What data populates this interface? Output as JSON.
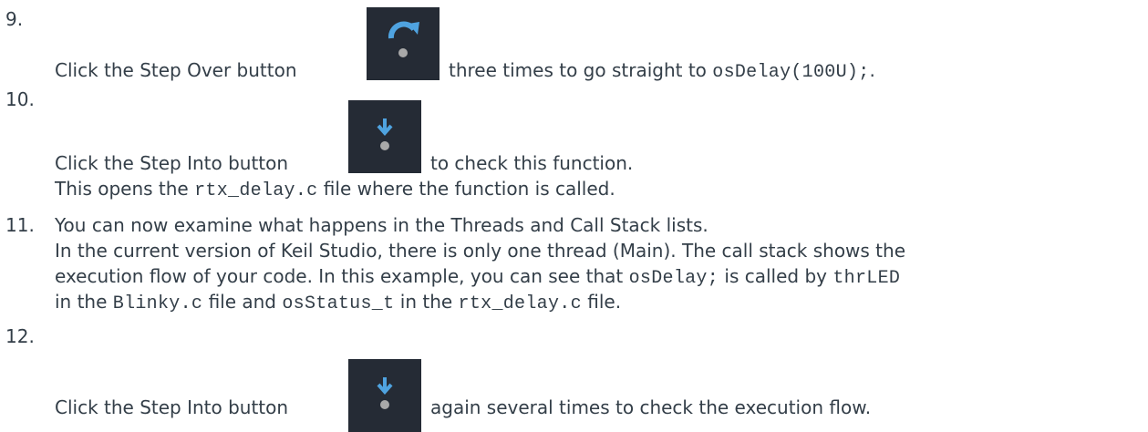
{
  "steps": [
    {
      "number": "9.",
      "icon": "step-over-icon",
      "lines": [
        {
          "before": "Click the Step Over button",
          "after": "three times to go straight to",
          "code": "osDelay(100U);",
          "end": "."
        }
      ]
    },
    {
      "number": "10.",
      "icon": "step-into-icon",
      "lines": [
        {
          "before": "Click the Step Into button",
          "after": "to check this function."
        },
        {
          "text1": "This opens the",
          "code": "rtx_delay.c",
          "text2": "file where the function is called."
        }
      ]
    },
    {
      "number": "11.",
      "lines": [
        {
          "text": "You can now examine what happens in the Threads and Call Stack lists."
        },
        {
          "text": "In the current version of Keil Studio, there is only one thread (Main). The call stack shows the"
        },
        {
          "text1": "execution flow of your code. In this example, you can see that",
          "code1": "osDelay;",
          "text2": "is called by",
          "code2": "thrLED"
        },
        {
          "text1": "in the",
          "code1": "Blinky.c",
          "text2": "file and",
          "code2": "osStatus_t",
          "text3": "in the",
          "code3": "rtx_delay.c",
          "text4": "file."
        }
      ]
    },
    {
      "number": "12.",
      "icon": "step-into-icon",
      "lines": [
        {
          "before": "Click the Step Into button",
          "after": "again several times to check the execution flow."
        }
      ]
    }
  ],
  "colors": {
    "text": "#333e48",
    "icon_bg": "#252b35",
    "icon_arrow": "#4fa3e0",
    "icon_dot": "#a9a9a9"
  }
}
